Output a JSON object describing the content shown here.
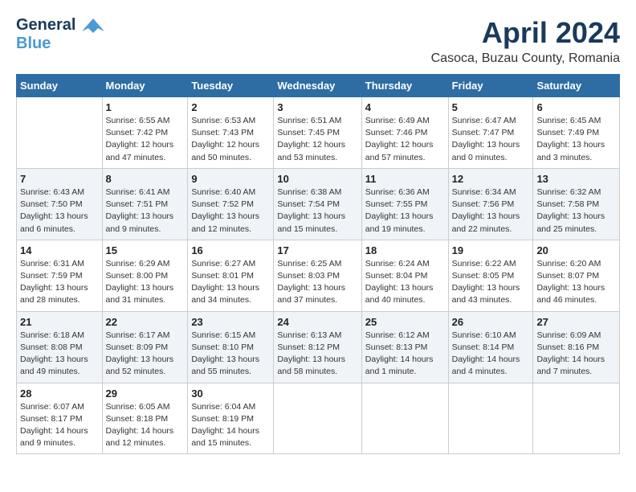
{
  "header": {
    "logo_line1": "General",
    "logo_line2": "Blue",
    "month": "April 2024",
    "location": "Casoca, Buzau County, Romania"
  },
  "weekdays": [
    "Sunday",
    "Monday",
    "Tuesday",
    "Wednesday",
    "Thursday",
    "Friday",
    "Saturday"
  ],
  "weeks": [
    [
      {
        "day": "",
        "info": ""
      },
      {
        "day": "1",
        "info": "Sunrise: 6:55 AM\nSunset: 7:42 PM\nDaylight: 12 hours\nand 47 minutes."
      },
      {
        "day": "2",
        "info": "Sunrise: 6:53 AM\nSunset: 7:43 PM\nDaylight: 12 hours\nand 50 minutes."
      },
      {
        "day": "3",
        "info": "Sunrise: 6:51 AM\nSunset: 7:45 PM\nDaylight: 12 hours\nand 53 minutes."
      },
      {
        "day": "4",
        "info": "Sunrise: 6:49 AM\nSunset: 7:46 PM\nDaylight: 12 hours\nand 57 minutes."
      },
      {
        "day": "5",
        "info": "Sunrise: 6:47 AM\nSunset: 7:47 PM\nDaylight: 13 hours\nand 0 minutes."
      },
      {
        "day": "6",
        "info": "Sunrise: 6:45 AM\nSunset: 7:49 PM\nDaylight: 13 hours\nand 3 minutes."
      }
    ],
    [
      {
        "day": "7",
        "info": "Sunrise: 6:43 AM\nSunset: 7:50 PM\nDaylight: 13 hours\nand 6 minutes."
      },
      {
        "day": "8",
        "info": "Sunrise: 6:41 AM\nSunset: 7:51 PM\nDaylight: 13 hours\nand 9 minutes."
      },
      {
        "day": "9",
        "info": "Sunrise: 6:40 AM\nSunset: 7:52 PM\nDaylight: 13 hours\nand 12 minutes."
      },
      {
        "day": "10",
        "info": "Sunrise: 6:38 AM\nSunset: 7:54 PM\nDaylight: 13 hours\nand 15 minutes."
      },
      {
        "day": "11",
        "info": "Sunrise: 6:36 AM\nSunset: 7:55 PM\nDaylight: 13 hours\nand 19 minutes."
      },
      {
        "day": "12",
        "info": "Sunrise: 6:34 AM\nSunset: 7:56 PM\nDaylight: 13 hours\nand 22 minutes."
      },
      {
        "day": "13",
        "info": "Sunrise: 6:32 AM\nSunset: 7:58 PM\nDaylight: 13 hours\nand 25 minutes."
      }
    ],
    [
      {
        "day": "14",
        "info": "Sunrise: 6:31 AM\nSunset: 7:59 PM\nDaylight: 13 hours\nand 28 minutes."
      },
      {
        "day": "15",
        "info": "Sunrise: 6:29 AM\nSunset: 8:00 PM\nDaylight: 13 hours\nand 31 minutes."
      },
      {
        "day": "16",
        "info": "Sunrise: 6:27 AM\nSunset: 8:01 PM\nDaylight: 13 hours\nand 34 minutes."
      },
      {
        "day": "17",
        "info": "Sunrise: 6:25 AM\nSunset: 8:03 PM\nDaylight: 13 hours\nand 37 minutes."
      },
      {
        "day": "18",
        "info": "Sunrise: 6:24 AM\nSunset: 8:04 PM\nDaylight: 13 hours\nand 40 minutes."
      },
      {
        "day": "19",
        "info": "Sunrise: 6:22 AM\nSunset: 8:05 PM\nDaylight: 13 hours\nand 43 minutes."
      },
      {
        "day": "20",
        "info": "Sunrise: 6:20 AM\nSunset: 8:07 PM\nDaylight: 13 hours\nand 46 minutes."
      }
    ],
    [
      {
        "day": "21",
        "info": "Sunrise: 6:18 AM\nSunset: 8:08 PM\nDaylight: 13 hours\nand 49 minutes."
      },
      {
        "day": "22",
        "info": "Sunrise: 6:17 AM\nSunset: 8:09 PM\nDaylight: 13 hours\nand 52 minutes."
      },
      {
        "day": "23",
        "info": "Sunrise: 6:15 AM\nSunset: 8:10 PM\nDaylight: 13 hours\nand 55 minutes."
      },
      {
        "day": "24",
        "info": "Sunrise: 6:13 AM\nSunset: 8:12 PM\nDaylight: 13 hours\nand 58 minutes."
      },
      {
        "day": "25",
        "info": "Sunrise: 6:12 AM\nSunset: 8:13 PM\nDaylight: 14 hours\nand 1 minute."
      },
      {
        "day": "26",
        "info": "Sunrise: 6:10 AM\nSunset: 8:14 PM\nDaylight: 14 hours\nand 4 minutes."
      },
      {
        "day": "27",
        "info": "Sunrise: 6:09 AM\nSunset: 8:16 PM\nDaylight: 14 hours\nand 7 minutes."
      }
    ],
    [
      {
        "day": "28",
        "info": "Sunrise: 6:07 AM\nSunset: 8:17 PM\nDaylight: 14 hours\nand 9 minutes."
      },
      {
        "day": "29",
        "info": "Sunrise: 6:05 AM\nSunset: 8:18 PM\nDaylight: 14 hours\nand 12 minutes."
      },
      {
        "day": "30",
        "info": "Sunrise: 6:04 AM\nSunset: 8:19 PM\nDaylight: 14 hours\nand 15 minutes."
      },
      {
        "day": "",
        "info": ""
      },
      {
        "day": "",
        "info": ""
      },
      {
        "day": "",
        "info": ""
      },
      {
        "day": "",
        "info": ""
      }
    ]
  ]
}
